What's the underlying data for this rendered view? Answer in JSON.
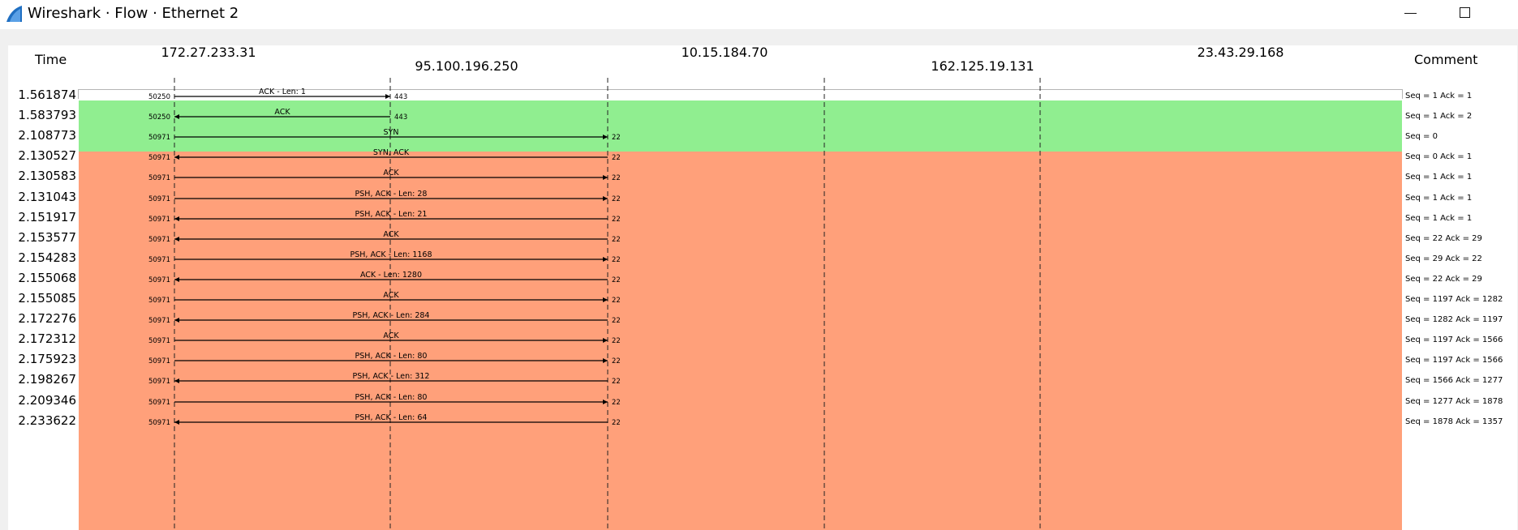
{
  "window": {
    "title": "Wireshark · Flow · Ethernet 2",
    "controls": [
      "minimize",
      "maximize"
    ]
  },
  "columns": {
    "time": "Time",
    "comment": "Comment"
  },
  "hosts": [
    "172.27.233.31",
    "95.100.196.250",
    "10.15.184.70",
    "162.125.19.131",
    "23.43.29.168"
  ],
  "colors": {
    "green": "#90ee90",
    "salmon": "#ffa07a",
    "titlebar": "#ffffff",
    "icon": "#1f6fc2"
  },
  "flows": [
    {
      "time": "1.561874",
      "from": 0,
      "to": 1,
      "label": "ACK - Len: 1",
      "src_port": "50250",
      "dst_port": "443",
      "comment": "Seq = 1 Ack = 1",
      "color": "green"
    },
    {
      "time": "1.583793",
      "from": 1,
      "to": 0,
      "label": "ACK",
      "src_port": "50250",
      "dst_port": "443",
      "comment": "Seq = 1 Ack = 2",
      "color": "green"
    },
    {
      "time": "2.108773",
      "from": 0,
      "to": 2,
      "label": "SYN",
      "src_port": "50971",
      "dst_port": "22",
      "comment": "Seq = 0",
      "color": "salmon"
    },
    {
      "time": "2.130527",
      "from": 2,
      "to": 0,
      "label": "SYN, ACK",
      "src_port": "50971",
      "dst_port": "22",
      "comment": "Seq = 0 Ack = 1",
      "color": "salmon"
    },
    {
      "time": "2.130583",
      "from": 0,
      "to": 2,
      "label": "ACK",
      "src_port": "50971",
      "dst_port": "22",
      "comment": "Seq = 1 Ack = 1",
      "color": "salmon"
    },
    {
      "time": "2.131043",
      "from": 0,
      "to": 2,
      "label": "PSH, ACK - Len: 28",
      "src_port": "50971",
      "dst_port": "22",
      "comment": "Seq = 1 Ack = 1",
      "color": "salmon"
    },
    {
      "time": "2.151917",
      "from": 2,
      "to": 0,
      "label": "PSH, ACK - Len: 21",
      "src_port": "50971",
      "dst_port": "22",
      "comment": "Seq = 1 Ack = 1",
      "color": "salmon"
    },
    {
      "time": "2.153577",
      "from": 2,
      "to": 0,
      "label": "ACK",
      "src_port": "50971",
      "dst_port": "22",
      "comment": "Seq = 22 Ack = 29",
      "color": "salmon"
    },
    {
      "time": "2.154283",
      "from": 0,
      "to": 2,
      "label": "PSH, ACK - Len: 1168",
      "src_port": "50971",
      "dst_port": "22",
      "comment": "Seq = 29 Ack = 22",
      "color": "salmon"
    },
    {
      "time": "2.155068",
      "from": 2,
      "to": 0,
      "label": "ACK - Len: 1280",
      "src_port": "50971",
      "dst_port": "22",
      "comment": "Seq = 22 Ack = 29",
      "color": "salmon"
    },
    {
      "time": "2.155085",
      "from": 0,
      "to": 2,
      "label": "ACK",
      "src_port": "50971",
      "dst_port": "22",
      "comment": "Seq = 1197 Ack = 1282",
      "color": "salmon"
    },
    {
      "time": "2.172276",
      "from": 2,
      "to": 0,
      "label": "PSH, ACK - Len: 284",
      "src_port": "50971",
      "dst_port": "22",
      "comment": "Seq = 1282 Ack = 1197",
      "color": "salmon"
    },
    {
      "time": "2.172312",
      "from": 0,
      "to": 2,
      "label": "ACK",
      "src_port": "50971",
      "dst_port": "22",
      "comment": "Seq = 1197 Ack = 1566",
      "color": "salmon"
    },
    {
      "time": "2.175923",
      "from": 0,
      "to": 2,
      "label": "PSH, ACK - Len: 80",
      "src_port": "50971",
      "dst_port": "22",
      "comment": "Seq = 1197 Ack = 1566",
      "color": "salmon"
    },
    {
      "time": "2.198267",
      "from": 2,
      "to": 0,
      "label": "PSH, ACK - Len: 312",
      "src_port": "50971",
      "dst_port": "22",
      "comment": "Seq = 1566 Ack = 1277",
      "color": "salmon"
    },
    {
      "time": "2.209346",
      "from": 0,
      "to": 2,
      "label": "PSH, ACK - Len: 80",
      "src_port": "50971",
      "dst_port": "22",
      "comment": "Seq = 1277 Ack = 1878",
      "color": "salmon"
    },
    {
      "time": "2.233622",
      "from": 2,
      "to": 0,
      "label": "PSH, ACK - Len: 64",
      "src_port": "50971",
      "dst_port": "22",
      "comment": "Seq = 1878 Ack = 1357",
      "color": "salmon"
    }
  ]
}
